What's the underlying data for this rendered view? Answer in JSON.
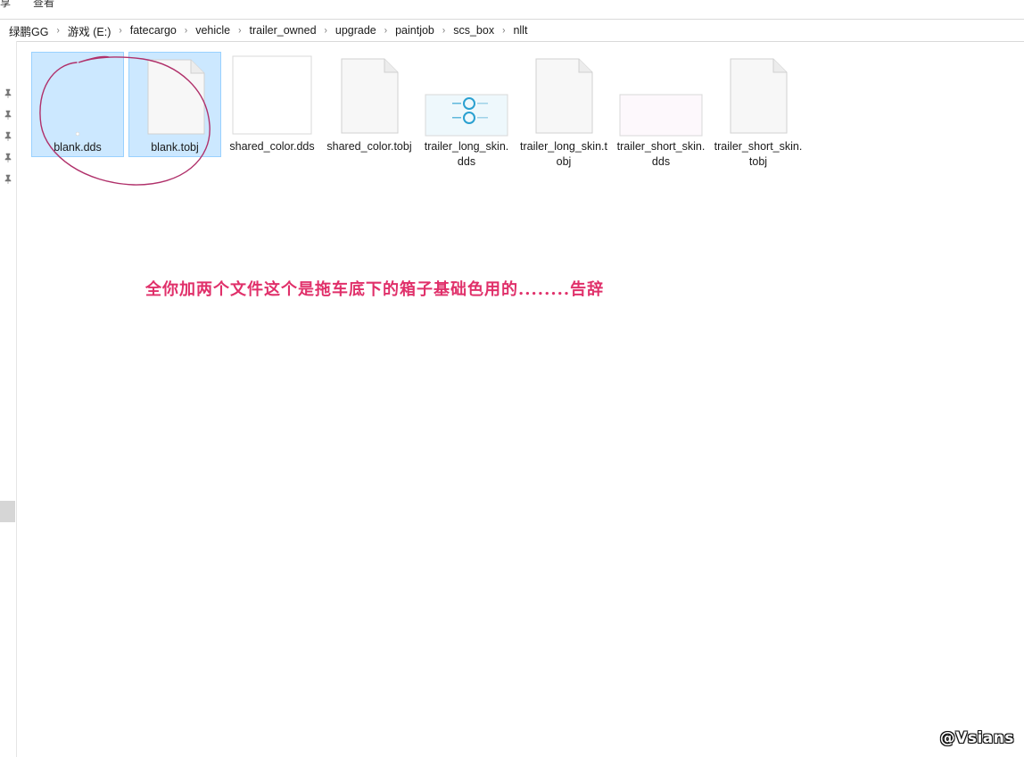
{
  "ribbon": {
    "left_label": "享",
    "view_label": "查看"
  },
  "breadcrumb": [
    "绿鹏GG",
    "游戏 (E:)",
    "fatecargo",
    "vehicle",
    "trailer_owned",
    "upgrade",
    "paintjob",
    "scs_box",
    "nllt"
  ],
  "files": [
    {
      "name": "blank.dds",
      "type": "blank-image",
      "selected": true
    },
    {
      "name": "blank.tobj",
      "type": "document",
      "selected": true
    },
    {
      "name": "shared_color.dds",
      "type": "white-image",
      "selected": false
    },
    {
      "name": "shared_color.tobj",
      "type": "document",
      "selected": false
    },
    {
      "name": "trailer_long_skin.dds",
      "type": "skin-image",
      "selected": false
    },
    {
      "name": "trailer_long_skin.tobj",
      "type": "document",
      "selected": false
    },
    {
      "name": "trailer_short_skin.dds",
      "type": "pale-image",
      "selected": false
    },
    {
      "name": "trailer_short_skin.tobj",
      "type": "document",
      "selected": false
    }
  ],
  "annotation_text": "全你加两个文件这个是拖车底下的箱子基础色用的........告辞",
  "watermark": "@Vsians",
  "colors": {
    "selection": "#cce8ff",
    "selection_border": "#99d1ff",
    "annotation": "#e0306a",
    "circle": "#b0306a"
  }
}
